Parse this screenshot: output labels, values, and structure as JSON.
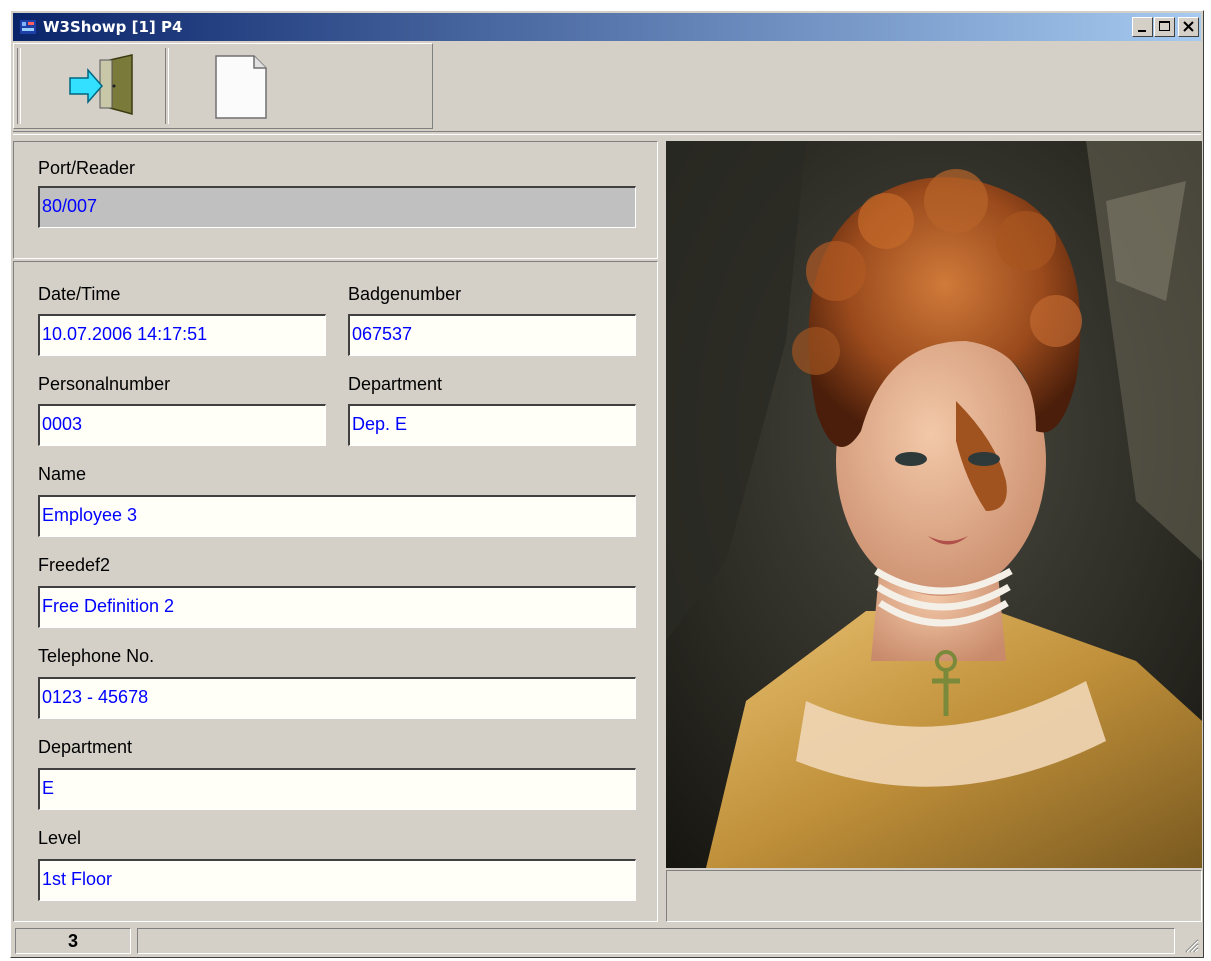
{
  "window": {
    "title": "W3Showp [1] P4",
    "icons": [
      "app-icon",
      "minimize-icon",
      "maximize-icon",
      "close-icon"
    ]
  },
  "toolbar": {
    "buttons": [
      {
        "icon": "exit-door-icon"
      },
      {
        "icon": "new-document-icon"
      }
    ]
  },
  "port_reader": {
    "label": "Port/Reader",
    "value": "80/007"
  },
  "fields": {
    "date_time": {
      "label": "Date/Time",
      "value": "10.07.2006 14:17:51"
    },
    "badgenumber": {
      "label": "Badgenumber",
      "value": "067537"
    },
    "personalnumber": {
      "label": "Personalnumber",
      "value": "0003"
    },
    "department_short": {
      "label": "Department",
      "value": "Dep. E"
    },
    "name": {
      "label": "Name",
      "value": "Employee 3"
    },
    "freedef2": {
      "label": "Freedef2",
      "value": "Free Definition 2"
    },
    "telephone": {
      "label": "Telephone No.",
      "value": "0123 - 45678"
    },
    "department": {
      "label": "Department",
      "value": "E"
    },
    "level": {
      "label": "Level",
      "value": "1st Floor"
    }
  },
  "photo": {
    "description_icon": "employee-photo"
  },
  "statusbar": {
    "count": "3"
  },
  "colors": {
    "window_bg": "#d4d0c8",
    "title_gradient_start": "#0a246a",
    "title_gradient_end": "#a6caf0",
    "field_value_text": "#0000ff",
    "field_bg": "#fffff8",
    "readonly_field_bg": "#c0c0c0"
  }
}
